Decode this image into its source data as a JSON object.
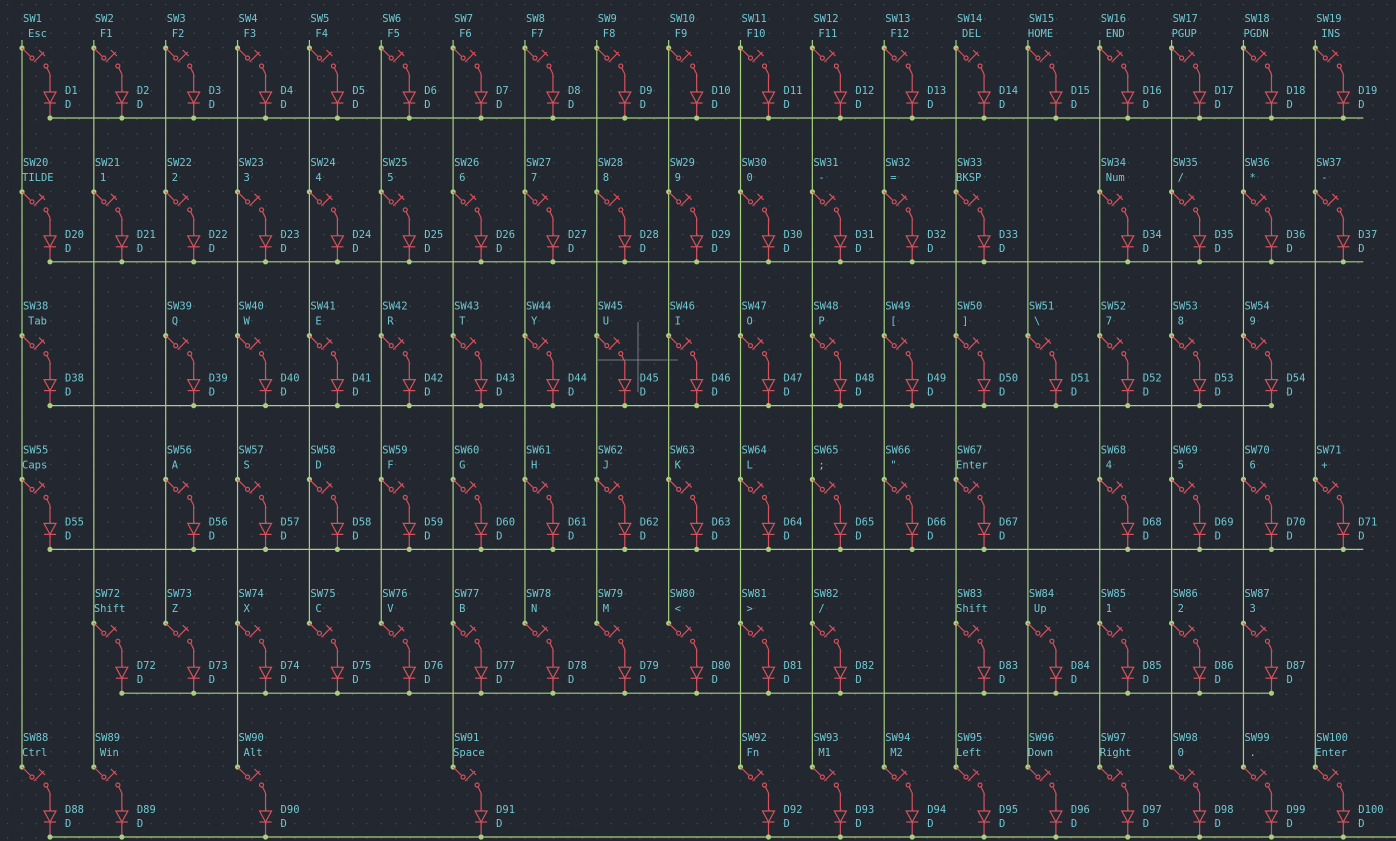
{
  "schematic": {
    "rows": [
      {
        "switches": [
          {
            "col": 0,
            "sw": "SW1",
            "label": "Esc",
            "d": "D1"
          },
          {
            "col": 1,
            "sw": "SW2",
            "label": "F1",
            "d": "D2"
          },
          {
            "col": 2,
            "sw": "SW3",
            "label": "F2",
            "d": "D3"
          },
          {
            "col": 3,
            "sw": "SW4",
            "label": "F3",
            "d": "D4"
          },
          {
            "col": 4,
            "sw": "SW5",
            "label": "F4",
            "d": "D5"
          },
          {
            "col": 5,
            "sw": "SW6",
            "label": "F5",
            "d": "D6"
          },
          {
            "col": 6,
            "sw": "SW7",
            "label": "F6",
            "d": "D7"
          },
          {
            "col": 7,
            "sw": "SW8",
            "label": "F7",
            "d": "D8"
          },
          {
            "col": 8,
            "sw": "SW9",
            "label": "F8",
            "d": "D9"
          },
          {
            "col": 9,
            "sw": "SW10",
            "label": "F9",
            "d": "D10"
          },
          {
            "col": 10,
            "sw": "SW11",
            "label": "F10",
            "d": "D11"
          },
          {
            "col": 11,
            "sw": "SW12",
            "label": "F11",
            "d": "D12"
          },
          {
            "col": 12,
            "sw": "SW13",
            "label": "F12",
            "d": "D13"
          },
          {
            "col": 13,
            "sw": "SW14",
            "label": "DEL",
            "d": "D14"
          },
          {
            "col": 14,
            "sw": "SW15",
            "label": "HOME",
            "d": "D15"
          },
          {
            "col": 15,
            "sw": "SW16",
            "label": "END",
            "d": "D16"
          },
          {
            "col": 16,
            "sw": "SW17",
            "label": "PGUP",
            "d": "D17"
          },
          {
            "col": 17,
            "sw": "SW18",
            "label": "PGDN",
            "d": "D18"
          },
          {
            "col": 18,
            "sw": "SW19",
            "label": "INS",
            "d": "D19"
          }
        ]
      },
      {
        "switches": [
          {
            "col": 0,
            "sw": "SW20",
            "label": "TILDE",
            "d": "D20"
          },
          {
            "col": 1,
            "sw": "SW21",
            "label": "1",
            "d": "D21"
          },
          {
            "col": 2,
            "sw": "SW22",
            "label": "2",
            "d": "D22"
          },
          {
            "col": 3,
            "sw": "SW23",
            "label": "3",
            "d": "D23"
          },
          {
            "col": 4,
            "sw": "SW24",
            "label": "4",
            "d": "D24"
          },
          {
            "col": 5,
            "sw": "SW25",
            "label": "5",
            "d": "D25"
          },
          {
            "col": 6,
            "sw": "SW26",
            "label": "6",
            "d": "D26"
          },
          {
            "col": 7,
            "sw": "SW27",
            "label": "7",
            "d": "D27"
          },
          {
            "col": 8,
            "sw": "SW28",
            "label": "8",
            "d": "D28"
          },
          {
            "col": 9,
            "sw": "SW29",
            "label": "9",
            "d": "D29"
          },
          {
            "col": 10,
            "sw": "SW30",
            "label": "0",
            "d": "D30"
          },
          {
            "col": 11,
            "sw": "SW31",
            "label": "-",
            "d": "D31"
          },
          {
            "col": 12,
            "sw": "SW32",
            "label": "=",
            "d": "D32"
          },
          {
            "col": 13,
            "sw": "SW33",
            "label": "BKSP",
            "d": "D33"
          },
          {
            "col": 15,
            "sw": "SW34",
            "label": "Num",
            "d": "D34"
          },
          {
            "col": 16,
            "sw": "SW35",
            "label": "/",
            "d": "D35"
          },
          {
            "col": 17,
            "sw": "SW36",
            "label": "*",
            "d": "D36"
          },
          {
            "col": 18,
            "sw": "SW37",
            "label": "-",
            "d": "D37"
          }
        ]
      },
      {
        "switches": [
          {
            "col": 0,
            "sw": "SW38",
            "label": "Tab",
            "d": "D38"
          },
          {
            "col": 2,
            "sw": "SW39",
            "label": "Q",
            "d": "D39"
          },
          {
            "col": 3,
            "sw": "SW40",
            "label": "W",
            "d": "D40"
          },
          {
            "col": 4,
            "sw": "SW41",
            "label": "E",
            "d": "D41"
          },
          {
            "col": 5,
            "sw": "SW42",
            "label": "R",
            "d": "D42"
          },
          {
            "col": 6,
            "sw": "SW43",
            "label": "T",
            "d": "D43"
          },
          {
            "col": 7,
            "sw": "SW44",
            "label": "Y",
            "d": "D44"
          },
          {
            "col": 8,
            "sw": "SW45",
            "label": "U",
            "d": "D45"
          },
          {
            "col": 9,
            "sw": "SW46",
            "label": "I",
            "d": "D46"
          },
          {
            "col": 10,
            "sw": "SW47",
            "label": "O",
            "d": "D47"
          },
          {
            "col": 11,
            "sw": "SW48",
            "label": "P",
            "d": "D48"
          },
          {
            "col": 12,
            "sw": "SW49",
            "label": "[",
            "d": "D49"
          },
          {
            "col": 13,
            "sw": "SW50",
            "label": "]",
            "d": "D50"
          },
          {
            "col": 14,
            "sw": "SW51",
            "label": "\\",
            "d": "D51"
          },
          {
            "col": 15,
            "sw": "SW52",
            "label": "7",
            "d": "D52"
          },
          {
            "col": 16,
            "sw": "SW53",
            "label": "8",
            "d": "D53"
          },
          {
            "col": 17,
            "sw": "SW54",
            "label": "9",
            "d": "D54"
          }
        ]
      },
      {
        "switches": [
          {
            "col": 0,
            "sw": "SW55",
            "label": "Caps",
            "d": "D55"
          },
          {
            "col": 2,
            "sw": "SW56",
            "label": "A",
            "d": "D56"
          },
          {
            "col": 3,
            "sw": "SW57",
            "label": "S",
            "d": "D57"
          },
          {
            "col": 4,
            "sw": "SW58",
            "label": "D",
            "d": "D58"
          },
          {
            "col": 5,
            "sw": "SW59",
            "label": "F",
            "d": "D59"
          },
          {
            "col": 6,
            "sw": "SW60",
            "label": "G",
            "d": "D60"
          },
          {
            "col": 7,
            "sw": "SW61",
            "label": "H",
            "d": "D61"
          },
          {
            "col": 8,
            "sw": "SW62",
            "label": "J",
            "d": "D62"
          },
          {
            "col": 9,
            "sw": "SW63",
            "label": "K",
            "d": "D63"
          },
          {
            "col": 10,
            "sw": "SW64",
            "label": "L",
            "d": "D64"
          },
          {
            "col": 11,
            "sw": "SW65",
            "label": ";",
            "d": "D65"
          },
          {
            "col": 12,
            "sw": "SW66",
            "label": "\"",
            "d": "D66"
          },
          {
            "col": 13,
            "sw": "SW67",
            "label": "Enter",
            "d": "D67"
          },
          {
            "col": 15,
            "sw": "SW68",
            "label": "4",
            "d": "D68"
          },
          {
            "col": 16,
            "sw": "SW69",
            "label": "5",
            "d": "D69"
          },
          {
            "col": 17,
            "sw": "SW70",
            "label": "6",
            "d": "D70"
          },
          {
            "col": 18,
            "sw": "SW71",
            "label": "+",
            "d": "D71"
          }
        ]
      },
      {
        "switches": [
          {
            "col": 1,
            "sw": "SW72",
            "label": "Shift",
            "d": "D72"
          },
          {
            "col": 2,
            "sw": "SW73",
            "label": "Z",
            "d": "D73"
          },
          {
            "col": 3,
            "sw": "SW74",
            "label": "X",
            "d": "D74"
          },
          {
            "col": 4,
            "sw": "SW75",
            "label": "C",
            "d": "D75"
          },
          {
            "col": 5,
            "sw": "SW76",
            "label": "V",
            "d": "D76"
          },
          {
            "col": 6,
            "sw": "SW77",
            "label": "B",
            "d": "D77"
          },
          {
            "col": 7,
            "sw": "SW78",
            "label": "N",
            "d": "D78"
          },
          {
            "col": 8,
            "sw": "SW79",
            "label": "M",
            "d": "D79"
          },
          {
            "col": 9,
            "sw": "SW80",
            "label": "<",
            "d": "D80"
          },
          {
            "col": 10,
            "sw": "SW81",
            "label": ">",
            "d": "D81"
          },
          {
            "col": 11,
            "sw": "SW82",
            "label": "/",
            "d": "D82"
          },
          {
            "col": 13,
            "sw": "SW83",
            "label": "Shift",
            "d": "D83"
          },
          {
            "col": 14,
            "sw": "SW84",
            "label": "Up",
            "d": "D84"
          },
          {
            "col": 15,
            "sw": "SW85",
            "label": "1",
            "d": "D85"
          },
          {
            "col": 16,
            "sw": "SW86",
            "label": "2",
            "d": "D86"
          },
          {
            "col": 17,
            "sw": "SW87",
            "label": "3",
            "d": "D87"
          }
        ]
      },
      {
        "switches": [
          {
            "col": 0,
            "sw": "SW88",
            "label": "Ctrl",
            "d": "D88"
          },
          {
            "col": 1,
            "sw": "SW89",
            "label": "Win",
            "d": "D89"
          },
          {
            "col": 3,
            "sw": "SW90",
            "label": "Alt",
            "d": "D90"
          },
          {
            "col": 6,
            "sw": "SW91",
            "label": "Space",
            "d": "D91"
          },
          {
            "col": 10,
            "sw": "SW92",
            "label": "Fn",
            "d": "D92"
          },
          {
            "col": 11,
            "sw": "SW93",
            "label": "M1",
            "d": "D93"
          },
          {
            "col": 12,
            "sw": "SW94",
            "label": "M2",
            "d": "D94"
          },
          {
            "col": 13,
            "sw": "SW95",
            "label": "Left",
            "d": "D95"
          },
          {
            "col": 14,
            "sw": "SW96",
            "label": "Down",
            "d": "D96"
          },
          {
            "col": 15,
            "sw": "SW97",
            "label": "Right",
            "d": "D97"
          },
          {
            "col": 16,
            "sw": "SW98",
            "label": "0",
            "d": "D98"
          },
          {
            "col": 17,
            "sw": "SW99",
            "label": ".",
            "d": "D99"
          },
          {
            "col": 18,
            "sw": "SW100",
            "label": "Enter",
            "d": "D100"
          }
        ]
      }
    ],
    "diode_value": "D",
    "colors": {
      "background": "#232830",
      "symbol": "#d9505b",
      "wire": "#a8cf7e",
      "text": "#6fc8d2",
      "grid": "#4a525c"
    }
  }
}
